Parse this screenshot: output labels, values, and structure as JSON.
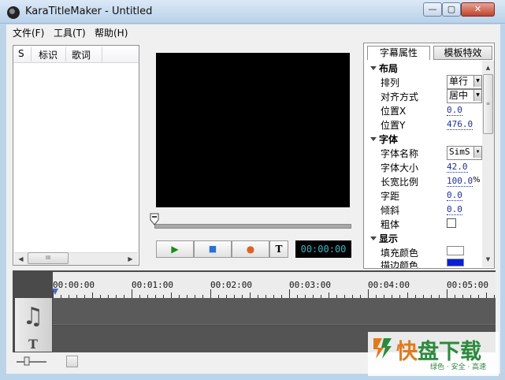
{
  "window": {
    "title": "KaraTitleMaker - Untitled",
    "min": "—",
    "max": "▢",
    "close": "✕"
  },
  "menu": [
    {
      "label": "文件(F)"
    },
    {
      "label": "工具(T)"
    },
    {
      "label": "帮助(H)"
    }
  ],
  "lyric_list": {
    "columns": [
      "S",
      "标识",
      "歌词"
    ],
    "scroll_thumb": "III"
  },
  "transport": {
    "play": "▶",
    "stop": "■",
    "record": "●",
    "text": "T",
    "time": "00:00:00"
  },
  "tabs": [
    {
      "label": "字幕属性",
      "active": true
    },
    {
      "label": "模板特效",
      "active": false
    }
  ],
  "properties": {
    "layout": {
      "title": "布局",
      "arrange_label": "排列",
      "arrange_value": "单行",
      "align_label": "对齐方式",
      "align_value": "居中",
      "pos_x_label": "位置X",
      "pos_x_value": "0.0",
      "pos_y_label": "位置Y",
      "pos_y_value": "476.0"
    },
    "font": {
      "title": "字体",
      "name_label": "字体名称",
      "name_value": "SimS",
      "size_label": "字体大小",
      "size_value": "42.0",
      "ratio_label": "长宽比例",
      "ratio_value": "100.0",
      "ratio_unit": "%",
      "spacing_label": "字距",
      "spacing_value": "0.0",
      "slant_label": "倾斜",
      "slant_value": "0.0",
      "bold_label": "粗体",
      "bold_checked": false
    },
    "display": {
      "title": "显示",
      "fill_label": "填充颜色",
      "fill_color": "#ffffff",
      "stroke_label": "描边颜色",
      "stroke_color": "#0a1ed8"
    }
  },
  "timeline": {
    "marks": [
      "00:00:00",
      "00:01:00",
      "00:02:00",
      "00:03:00",
      "00:04:00",
      "00:05:00"
    ]
  },
  "watermark": {
    "big_1": "快",
    "big_2": "盘下载",
    "small": "绿色 · 安全 · 高速"
  },
  "colors": {
    "accent": "#4a67c9",
    "time_text": "#3bb7c8",
    "watermark_green": "#2c8a3c",
    "watermark_orange": "#e07a1f"
  }
}
